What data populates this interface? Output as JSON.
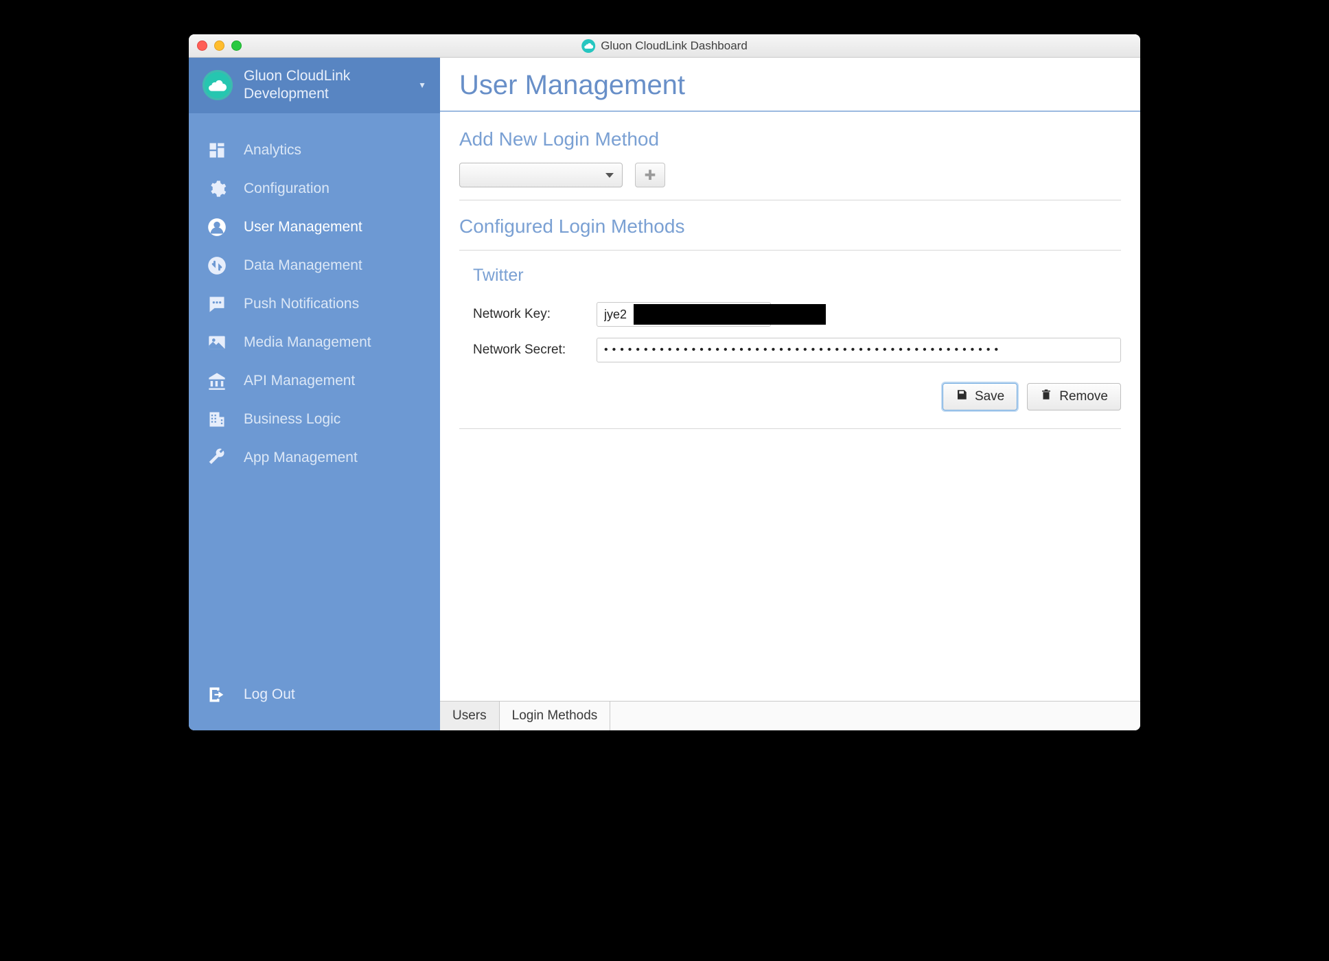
{
  "window": {
    "title": "Gluon CloudLink Dashboard"
  },
  "app_switcher": {
    "name": "Gluon CloudLink Development"
  },
  "sidebar": {
    "items": [
      {
        "label": "Analytics"
      },
      {
        "label": "Configuration"
      },
      {
        "label": "User Management"
      },
      {
        "label": "Data Management"
      },
      {
        "label": "Push Notifications"
      },
      {
        "label": "Media Management"
      },
      {
        "label": "API Management"
      },
      {
        "label": "Business Logic"
      },
      {
        "label": "App Management"
      }
    ],
    "logout_label": "Log Out"
  },
  "page": {
    "title": "User Management"
  },
  "sections": {
    "add_heading": "Add New Login Method",
    "configured_heading": "Configured Login Methods"
  },
  "login_method": {
    "provider": "Twitter",
    "network_key_label": "Network Key:",
    "network_key_value": "jye2",
    "network_secret_label": "Network Secret:",
    "network_secret_value": "••••••••••••••••••••••••••••••••••••••••••••••••••",
    "save_label": "Save",
    "remove_label": "Remove"
  },
  "tabs": {
    "users": "Users",
    "login_methods": "Login Methods"
  }
}
